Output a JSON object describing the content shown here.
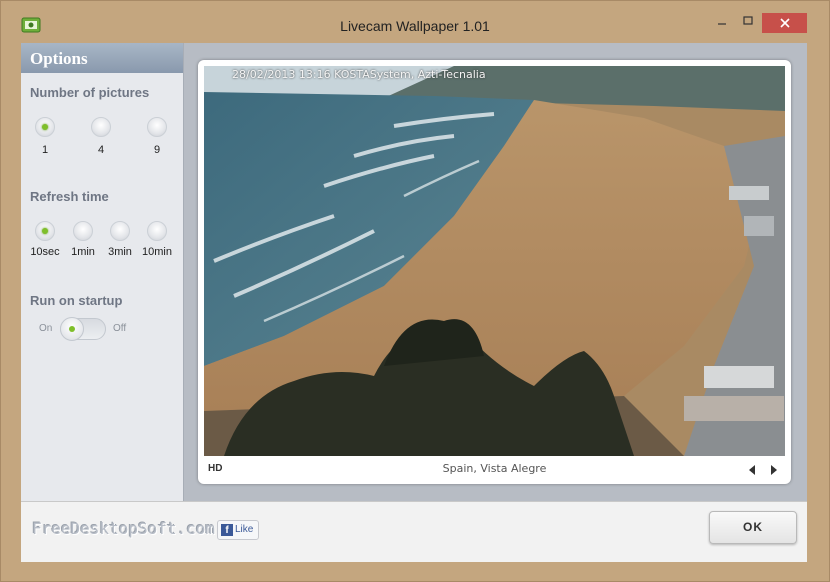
{
  "window": {
    "title": "Livecam Wallpaper 1.01",
    "minimize_icon": "minimize-icon",
    "maximize_icon": "maximize-icon",
    "close_icon": "close-icon"
  },
  "sidebar": {
    "header": "Options",
    "pictures": {
      "title": "Number of pictures",
      "options": [
        {
          "label": "1",
          "selected": true
        },
        {
          "label": "4",
          "selected": false
        },
        {
          "label": "9",
          "selected": false
        }
      ]
    },
    "refresh": {
      "title": "Refresh time",
      "options": [
        {
          "label": "10sec",
          "selected": true
        },
        {
          "label": "1min",
          "selected": false
        },
        {
          "label": "3min",
          "selected": false
        },
        {
          "label": "10min",
          "selected": false
        }
      ]
    },
    "startup": {
      "title": "Run on startup",
      "on_label": "On",
      "off_label": "Off",
      "enabled": true
    }
  },
  "viewer": {
    "overlay": "28/02/2013 13:16 KOSTASystem, Azti-Tecnalia",
    "quality": "HD",
    "location": "Spain, Vista Alegre",
    "prev_icon": "arrow-left-icon",
    "next_icon": "arrow-right-icon"
  },
  "footer": {
    "site": "FreeDesktopSoft.com",
    "like_label": "Like",
    "ok_label": "OK"
  },
  "colors": {
    "frame": "#c4a67f",
    "close": "#c7504a",
    "accent_green": "#7fbf2a",
    "sidebar_head": "#8999ad"
  }
}
